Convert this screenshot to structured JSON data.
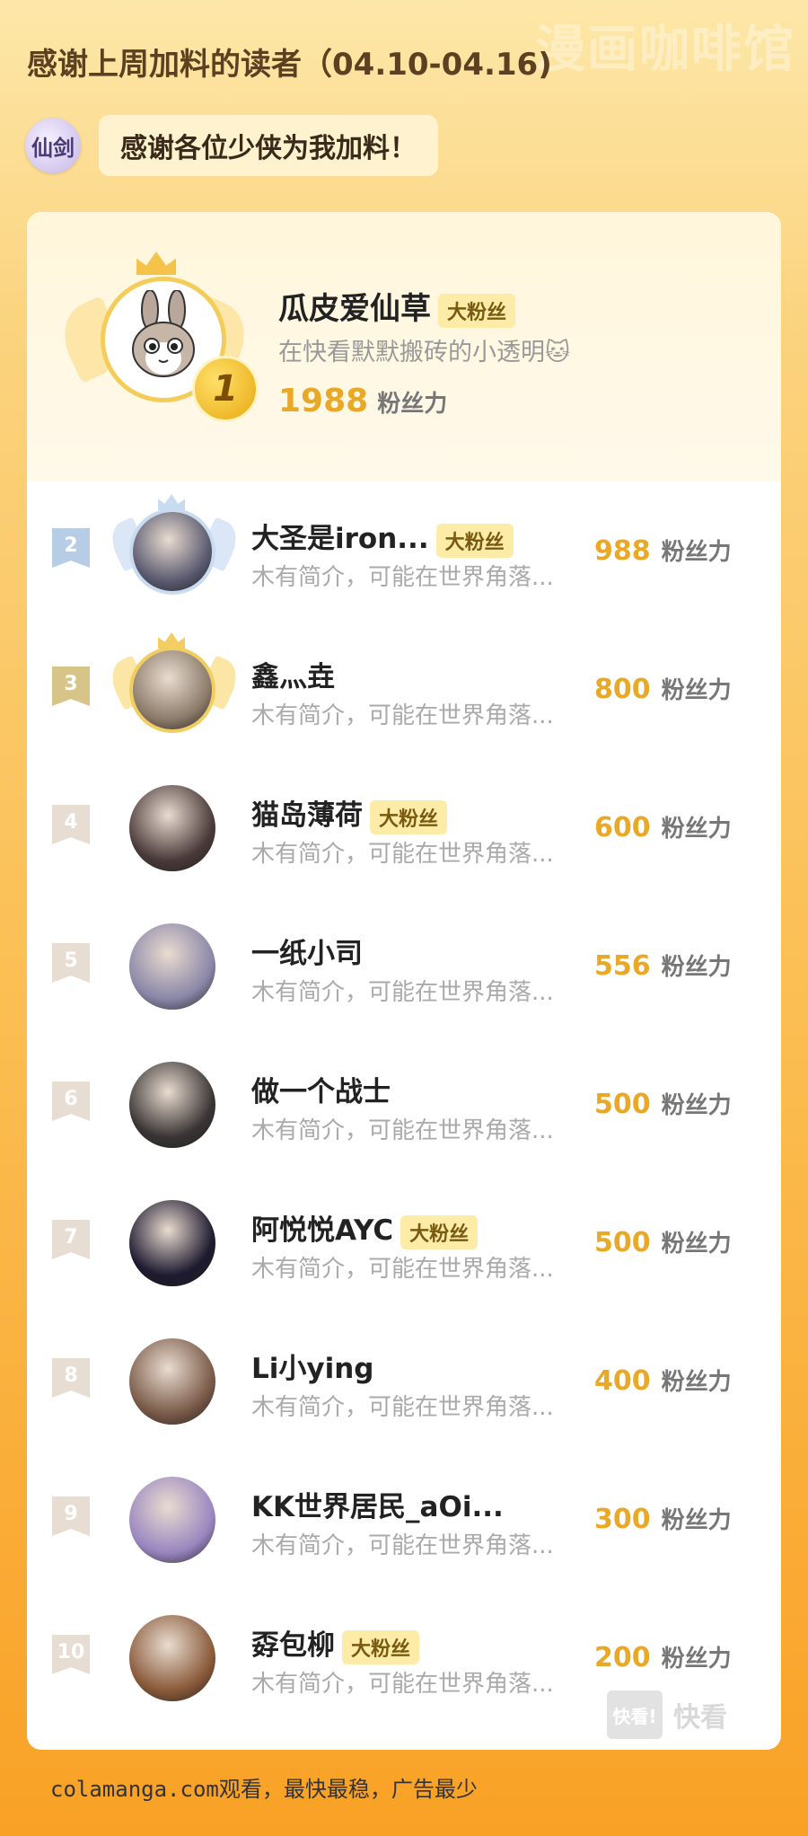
{
  "watermark": "漫画咖啡馆",
  "header": {
    "title": "感谢上周加料的读者（04.10-04.16)",
    "logo_text": "仙剑",
    "thanks": "感谢各位少侠为我加料！"
  },
  "top_reader": {
    "rank": "1",
    "name": "瓜皮爱仙草",
    "badge": "大粉丝",
    "desc": "在快看默默搬砖的小透明🐱",
    "score": "1988",
    "unit": "粉丝力"
  },
  "readers": [
    {
      "rank": "2",
      "name": "大圣是iron...",
      "badge": "大粉丝",
      "desc": "木有简介，可能在世界角落...",
      "score": "988",
      "unit": "粉丝力",
      "avatar_color": "#5a5a70"
    },
    {
      "rank": "3",
      "name": "鑫灬垚",
      "badge": "",
      "desc": "木有简介，可能在世界角落...",
      "score": "800",
      "unit": "粉丝力",
      "avatar_color": "#8c7b6a"
    },
    {
      "rank": "4",
      "name": "猫岛薄荷",
      "badge": "大粉丝",
      "desc": "木有简介，可能在世界角落...",
      "score": "600",
      "unit": "粉丝力",
      "avatar_color": "#4a3a3a"
    },
    {
      "rank": "5",
      "name": "一纸小司",
      "badge": "",
      "desc": "木有简介，可能在世界角落...",
      "score": "556",
      "unit": "粉丝力",
      "avatar_color": "#8a86a8"
    },
    {
      "rank": "6",
      "name": "做一个战士",
      "badge": "",
      "desc": "木有简介，可能在世界角落...",
      "score": "500",
      "unit": "粉丝力",
      "avatar_color": "#3a3535"
    },
    {
      "rank": "7",
      "name": "阿悦悦AYC",
      "badge": "大粉丝",
      "desc": "木有简介，可能在世界角落...",
      "score": "500",
      "unit": "粉丝力",
      "avatar_color": "#1e1a30"
    },
    {
      "rank": "8",
      "name": "Li小ying",
      "badge": "",
      "desc": "木有简介，可能在世界角落...",
      "score": "400",
      "unit": "粉丝力",
      "avatar_color": "#7a5a48"
    },
    {
      "rank": "9",
      "name": "KK世界居民_aOi...",
      "badge": "",
      "desc": "木有简介，可能在世界角落...",
      "score": "300",
      "unit": "粉丝力",
      "avatar_color": "#9a86c0"
    },
    {
      "rank": "10",
      "name": "孬包柳",
      "badge": "大粉丝",
      "desc": "木有简介，可能在世界角落...",
      "score": "200",
      "unit": "粉丝力",
      "avatar_color": "#8a5a3a"
    }
  ],
  "kuaikan_watermark": {
    "box": "快看!",
    "text": "快看"
  },
  "footer": "colamanga.com观看，最快最稳，广告最少"
}
